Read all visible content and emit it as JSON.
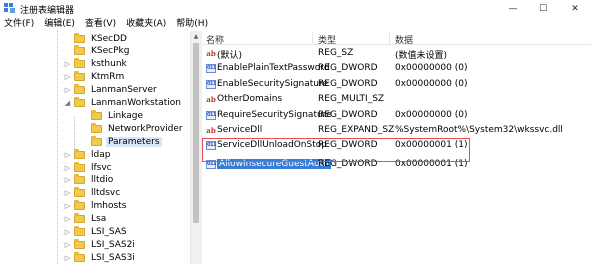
{
  "window": {
    "title": "注册表编辑器",
    "minimize_glyph": "—",
    "maximize_glyph": "☐",
    "close_glyph": "✕"
  },
  "menu": [
    "文件(F)",
    "编辑(E)",
    "查看(V)",
    "收藏夹(A)",
    "帮助(H)"
  ],
  "tree": {
    "items": [
      {
        "label": "KSecDD",
        "expandable": false,
        "level": 0
      },
      {
        "label": "KSecPkg",
        "expandable": false,
        "level": 0
      },
      {
        "label": "ksthunk",
        "expandable": true,
        "level": 0
      },
      {
        "label": "KtmRm",
        "expandable": true,
        "level": 0
      },
      {
        "label": "LanmanServer",
        "expandable": true,
        "level": 0
      },
      {
        "label": "LanmanWorkstation",
        "expandable": true,
        "expanded": true,
        "level": 0
      },
      {
        "label": "Linkage",
        "expandable": false,
        "level": 1
      },
      {
        "label": "NetworkProvider",
        "expandable": false,
        "level": 1
      },
      {
        "label": "Parameters",
        "expandable": false,
        "level": 1,
        "selected": true
      },
      {
        "label": "ldap",
        "expandable": true,
        "level": 0
      },
      {
        "label": "lfsvc",
        "expandable": true,
        "level": 0
      },
      {
        "label": "lltdio",
        "expandable": true,
        "level": 0
      },
      {
        "label": "lltdsvc",
        "expandable": true,
        "level": 0
      },
      {
        "label": "lmhosts",
        "expandable": true,
        "level": 0
      },
      {
        "label": "Lsa",
        "expandable": true,
        "level": 0
      },
      {
        "label": "LSI_SAS",
        "expandable": true,
        "level": 0
      },
      {
        "label": "LSI_SAS2i",
        "expandable": true,
        "level": 0
      },
      {
        "label": "LSI_SAS3i",
        "expandable": true,
        "level": 0
      }
    ]
  },
  "list": {
    "headers": {
      "name": "名称",
      "type": "类型",
      "data": "数据"
    },
    "rows": [
      {
        "icon": "string-value-icon",
        "name": "(默认)",
        "type": "REG_SZ",
        "data": "(数值未设置)"
      },
      {
        "icon": "binary-value-icon",
        "name": "EnablePlainTextPassword",
        "type": "REG_DWORD",
        "data": "0x00000000 (0)"
      },
      {
        "icon": "binary-value-icon",
        "name": "EnableSecuritySignature",
        "type": "REG_DWORD",
        "data": "0x00000000 (0)"
      },
      {
        "icon": "string-value-icon",
        "name": "OtherDomains",
        "type": "REG_MULTI_SZ",
        "data": ""
      },
      {
        "icon": "binary-value-icon",
        "name": "RequireSecuritySignature",
        "type": "REG_DWORD",
        "data": "0x00000000 (0)"
      },
      {
        "icon": "string-value-icon",
        "name": "ServiceDll",
        "type": "REG_EXPAND_SZ",
        "data": "%SystemRoot%\\System32\\wkssvc.dll"
      },
      {
        "icon": "binary-value-icon",
        "name": "ServiceDllUnloadOnStop",
        "type": "REG_DWORD",
        "data": "0x00000001 (1)"
      },
      {
        "icon": "binary-value-icon",
        "name": "AllowInsecureGuestAuth",
        "type": "REG_DWORD",
        "data": "0x00000001 (1)",
        "selected": true
      }
    ]
  },
  "icon_glyphs": {
    "string": "ab",
    "binary": "011"
  },
  "colors": {
    "selection": "#3a7bd5",
    "highlight_border": "#e05050",
    "folder": "#f2c94c"
  }
}
